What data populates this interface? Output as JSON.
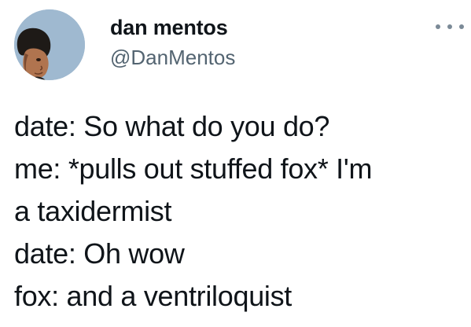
{
  "author": {
    "display_name": "dan mentos",
    "handle": "@DanMentos",
    "avatar_icon": "profile-photo"
  },
  "more_icon": "ellipsis-icon",
  "tweet": {
    "lines": [
      "date: So what do you do?",
      "me: *pulls out stuffed fox* I'm",
      "a taxidermist",
      "date: Oh wow",
      "fox: and a ventriloquist"
    ]
  },
  "colors": {
    "text": "#0f1419",
    "secondary_text": "#536471",
    "avatar_background": "#9fb9d0",
    "background": "#ffffff"
  }
}
